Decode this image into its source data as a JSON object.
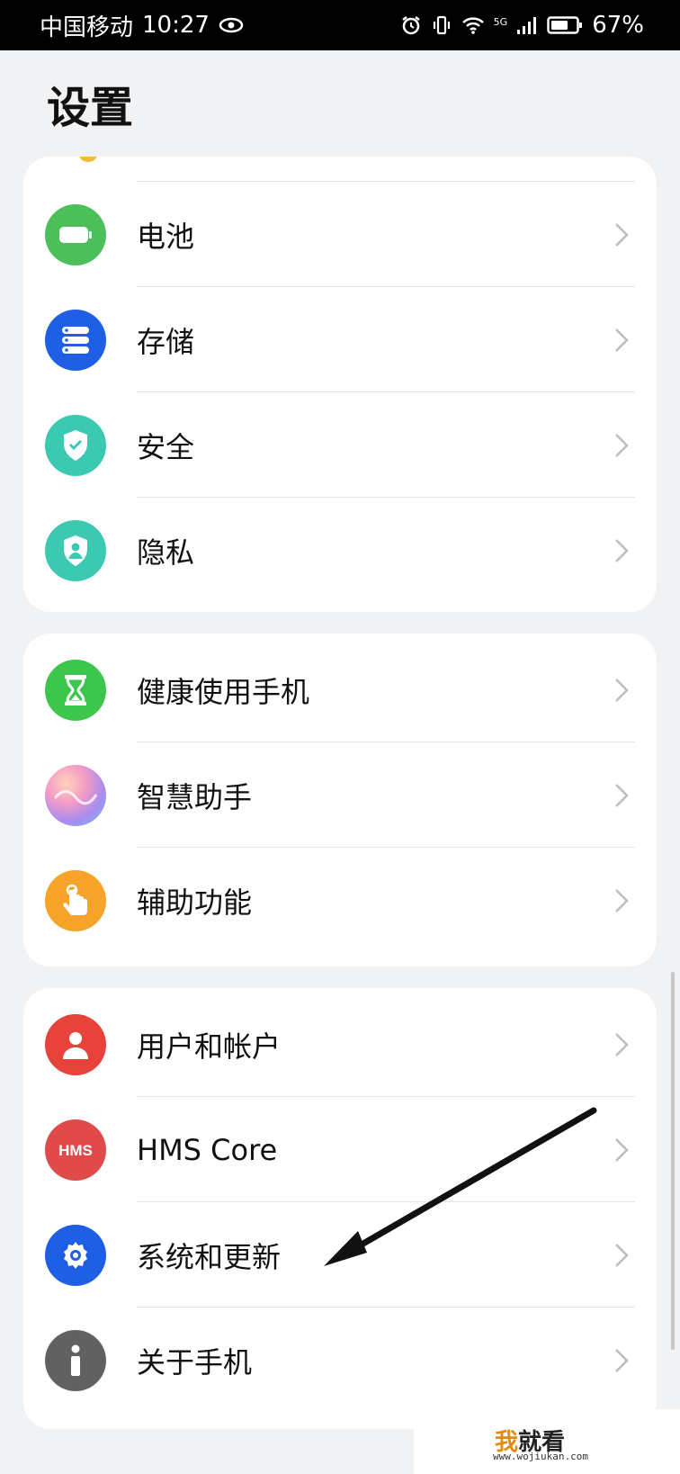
{
  "status_bar": {
    "carrier": "中国移动",
    "time": "10:27",
    "network": "5G",
    "battery": "67%"
  },
  "page_title": "设置",
  "groups": [
    {
      "items": [
        {
          "label": "电池",
          "icon": "battery-icon",
          "color": "#4cbf5b"
        },
        {
          "label": "存储",
          "icon": "storage-icon",
          "color": "#1f5fe6"
        },
        {
          "label": "安全",
          "icon": "shield-check-icon",
          "color": "#3cc9b2"
        },
        {
          "label": "隐私",
          "icon": "privacy-icon",
          "color": "#3cc9b2"
        }
      ]
    },
    {
      "items": [
        {
          "label": "健康使用手机",
          "icon": "hourglass-icon",
          "color": "#3cc64e"
        },
        {
          "label": "智慧助手",
          "icon": "assistant-icon",
          "color": "#c9a7f0"
        },
        {
          "label": "辅助功能",
          "icon": "hand-pointer-icon",
          "color": "#f6a32a"
        }
      ]
    },
    {
      "items": [
        {
          "label": "用户和帐户",
          "icon": "user-icon",
          "color": "#e7433a"
        },
        {
          "label": "HMS Core",
          "icon": "hms-icon",
          "color": "#e04a4a"
        },
        {
          "label": "系统和更新",
          "icon": "gear-icon",
          "color": "#1f5fe6"
        },
        {
          "label": "关于手机",
          "icon": "info-icon",
          "color": "#616161"
        }
      ]
    }
  ],
  "watermark": {
    "logo_highlight": "我",
    "logo_rest": "就看",
    "url": "www.wojiukan.com"
  }
}
